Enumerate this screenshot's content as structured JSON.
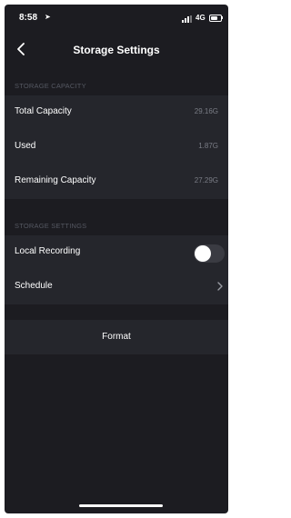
{
  "status_bar": {
    "time": "8:58",
    "network": "4G"
  },
  "nav": {
    "title": "Storage Settings"
  },
  "storage_capacity": {
    "header": "STORAGE CAPACITY",
    "rows": [
      {
        "label": "Total Capacity",
        "value": "29.16G"
      },
      {
        "label": "Used",
        "value": "1.87G"
      },
      {
        "label": "Remaining Capacity",
        "value": "27.29G"
      }
    ]
  },
  "storage_settings": {
    "header": "STORAGE SETTINGS",
    "local_recording": {
      "label": "Local Recording",
      "enabled": false
    },
    "schedule": {
      "label": "Schedule"
    }
  },
  "actions": {
    "format_label": "Format"
  },
  "colors": {
    "background": "#1c1c21",
    "row_background": "#25262c",
    "section_header_text": "#555862",
    "value_text": "#7a7d86"
  }
}
